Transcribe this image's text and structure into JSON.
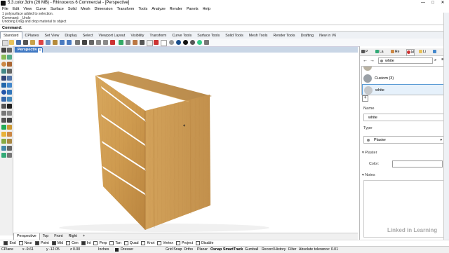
{
  "window": {
    "title": "5.3.color.3dm (26 MB) - Rhinoceros 6 Commercial - [Perspective]",
    "minimize": "—",
    "maximize": "□",
    "close": "✕"
  },
  "menu": [
    "File",
    "Edit",
    "View",
    "Curve",
    "Surface",
    "Solid",
    "Mesh",
    "Dimension",
    "Transform",
    "Tools",
    "Analyze",
    "Render",
    "Panels",
    "Help"
  ],
  "history": {
    "line1": "1 polysurface added to selection.",
    "line2": "Command: _Undo",
    "line3": "Undoing Drag and drop material to object"
  },
  "command": {
    "label": "Command:",
    "value": ""
  },
  "toolbar_tabs": [
    "Standard",
    "CPlanes",
    "Set View",
    "Display",
    "Select",
    "Viewport Layout",
    "Visibility",
    "Transform",
    "Curve Tools",
    "Surface Tools",
    "Solid Tools",
    "Mesh Tools",
    "Render Tools",
    "Drafting",
    "New in V6"
  ],
  "viewport": {
    "name": "Perspective",
    "dropdown": "▾"
  },
  "viewport_tabs": [
    "Perspective",
    "Top",
    "Front",
    "Right",
    "+"
  ],
  "osnap": [
    {
      "label": "End",
      "checked": true
    },
    {
      "label": "Near",
      "checked": false
    },
    {
      "label": "Point",
      "checked": true
    },
    {
      "label": "Mid",
      "checked": true
    },
    {
      "label": "Cen",
      "checked": false
    },
    {
      "label": "Int",
      "checked": true
    },
    {
      "label": "Perp",
      "checked": false
    },
    {
      "label": "Tan",
      "checked": false
    },
    {
      "label": "Quad",
      "checked": false
    },
    {
      "label": "Knot",
      "checked": false
    },
    {
      "label": "Vertex",
      "checked": false
    },
    {
      "label": "Project",
      "checked": false
    },
    {
      "label": "Disable",
      "checked": false
    }
  ],
  "status": {
    "cplane": "CPlane",
    "x": "x -9.61",
    "y": "y -12.05",
    "z": "z 0.00",
    "units": "Inches",
    "layer": "Dresser",
    "modes": [
      "Grid Snap",
      "Ortho",
      "Planar",
      "Osnap",
      "SmartTrack",
      "Gumball",
      "Record History",
      "Filter"
    ],
    "tolerance": "Absolute tolerance: 0.01"
  },
  "panel": {
    "tabs": [
      "P",
      "La",
      "Re",
      "M",
      "Li",
      ""
    ],
    "search_value": "white",
    "materials": [
      {
        "name": "",
        "color": "#b9b2a2"
      },
      {
        "name": "Custom (3)",
        "color": "#9aa0a6"
      },
      {
        "name": "white",
        "color": "#c4c7ca",
        "selected": true
      }
    ],
    "add": "+",
    "name_label": "Name",
    "name_value": "white",
    "type_label": "Type",
    "type_value": "Plaster",
    "plaster_label": "Plaster",
    "color_label": "Color:",
    "notes_label": "Notes"
  },
  "watermark": "Linked in Learning"
}
